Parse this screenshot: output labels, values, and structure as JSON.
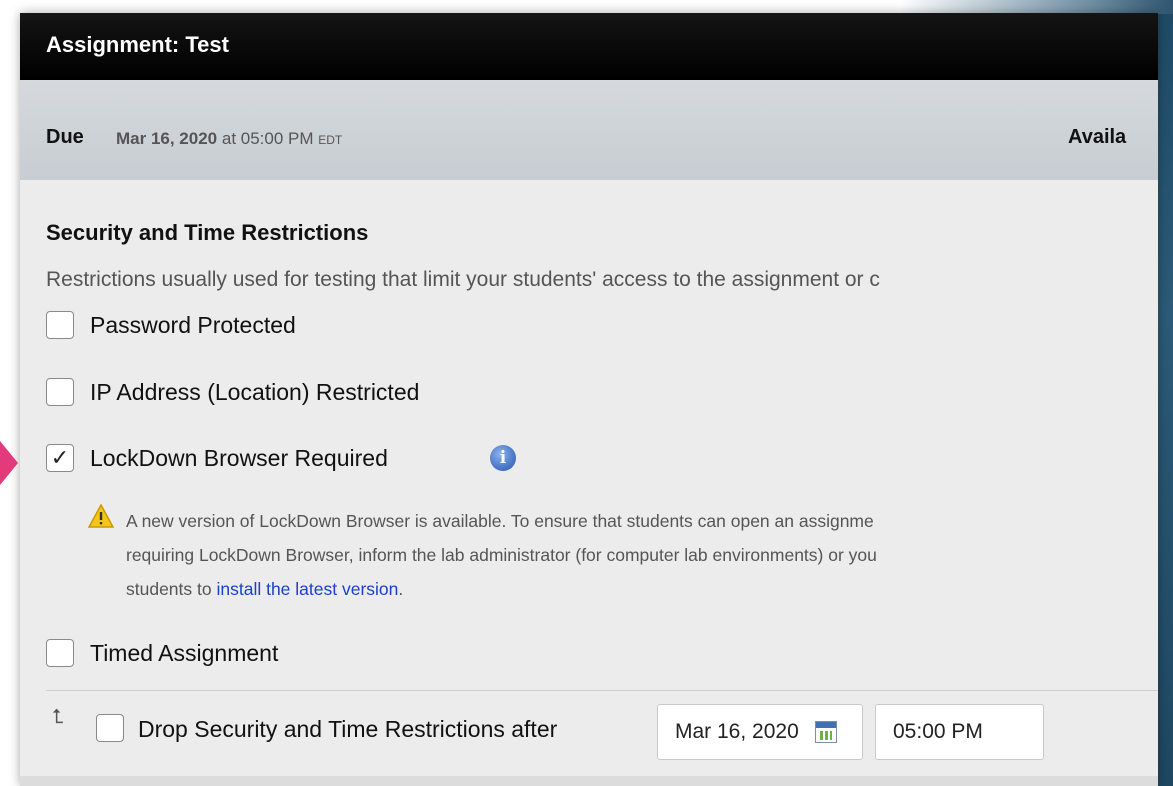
{
  "window": {
    "title": "Assignment: Test"
  },
  "due": {
    "label": "Due",
    "date": "Mar 16, 2020",
    "at": " at 05:00 PM ",
    "timezone": "EDT",
    "available_label": "Availa"
  },
  "security": {
    "title": "Security and Time Restrictions",
    "description": "Restrictions usually used for testing that limit your students' access to the assignment or c",
    "options": [
      {
        "label": "Password Protected",
        "checked": false
      },
      {
        "label": "IP Address (Location) Restricted",
        "checked": false
      },
      {
        "label": "LockDown Browser Required",
        "checked": true,
        "icon": "info-icon"
      },
      {
        "label": "Timed Assignment",
        "checked": false
      }
    ],
    "warning": {
      "icon": "warning-icon",
      "text_line1": "A new version of LockDown Browser is available. To ensure that students can open an assignme",
      "text_line2": "requiring LockDown Browser, inform the lab administrator (for computer lab environments) or you",
      "text_line3_prefix": "students to ",
      "link": "install the latest version",
      "text_line3_suffix": "."
    }
  },
  "drop": {
    "icon": "return-arrow-icon",
    "label": "Drop Security and Time Restrictions after",
    "checked": false,
    "date_value": "Mar 16, 2020",
    "time_value": "05:00 PM"
  },
  "colors": {
    "accent_pointer": "#e23a7a",
    "link": "#1a3fc9",
    "titlebar": "#000000"
  }
}
